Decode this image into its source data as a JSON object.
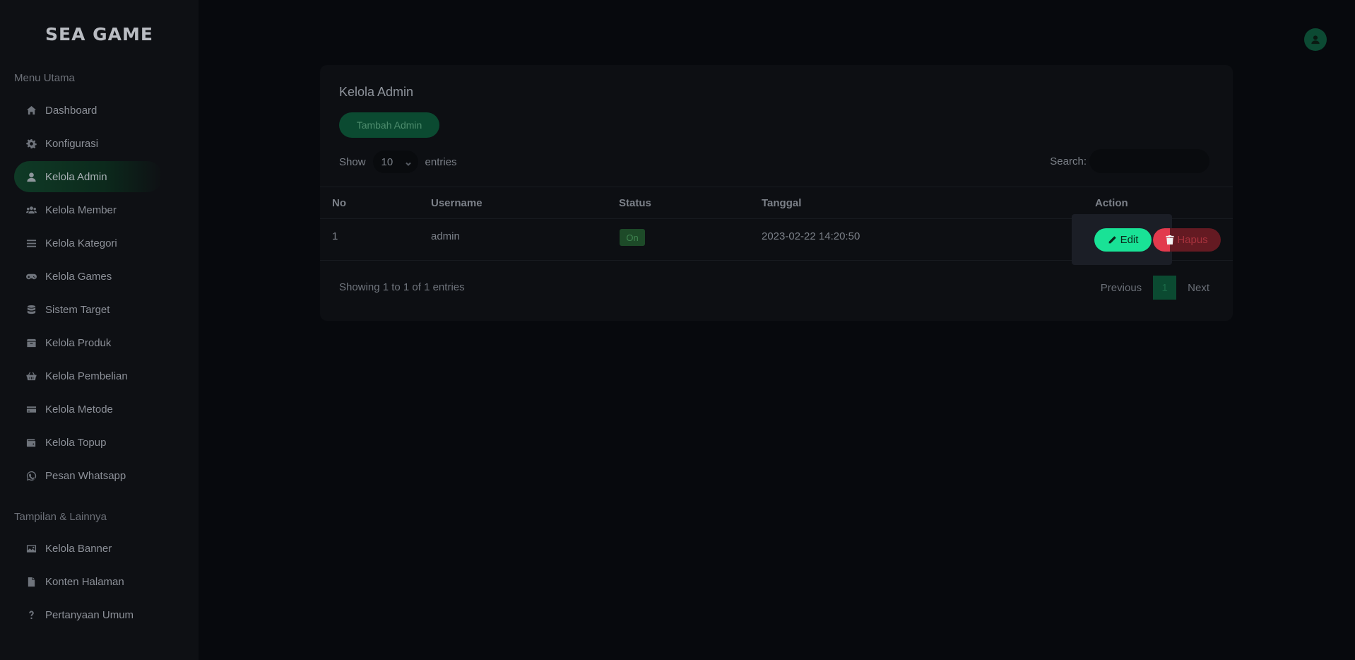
{
  "brand": {
    "logo_text": "SEA GAME"
  },
  "sidebar": {
    "section_main": "Menu Utama",
    "section_other": "Tampilan & Lainnya",
    "items": [
      {
        "label": "Dashboard",
        "icon": "home-icon"
      },
      {
        "label": "Konfigurasi",
        "icon": "gear-icon"
      },
      {
        "label": "Kelola Admin",
        "icon": "user-icon",
        "active": true
      },
      {
        "label": "Kelola Member",
        "icon": "users-icon"
      },
      {
        "label": "Kelola Kategori",
        "icon": "list-icon"
      },
      {
        "label": "Kelola Games",
        "icon": "gamepad-icon"
      },
      {
        "label": "Sistem Target",
        "icon": "database-icon"
      },
      {
        "label": "Kelola Produk",
        "icon": "box-icon"
      },
      {
        "label": "Kelola Pembelian",
        "icon": "basket-icon"
      },
      {
        "label": "Kelola Metode",
        "icon": "credit-card-icon"
      },
      {
        "label": "Kelola Topup",
        "icon": "wallet-icon"
      },
      {
        "label": "Pesan Whatsapp",
        "icon": "whatsapp-icon"
      },
      {
        "label": "Kelola Banner",
        "icon": "image-icon"
      },
      {
        "label": "Konten Halaman",
        "icon": "file-icon"
      },
      {
        "label": "Pertanyaan Umum",
        "icon": "question-icon"
      }
    ]
  },
  "header": {
    "avatar_icon": "user-circle-icon"
  },
  "card": {
    "title": "Kelola Admin",
    "add_button": "Tambah Admin",
    "show_label": "Show",
    "entries_value": "10",
    "entries_label": "entries",
    "search_label": "Search:",
    "search_value": "",
    "columns": [
      "No",
      "Username",
      "Status",
      "Tanggal",
      "Action"
    ],
    "rows": [
      {
        "no": "1",
        "username": "admin",
        "status": "On",
        "tanggal": "2023-02-22 14:20:50"
      }
    ],
    "edit_label": "Edit",
    "delete_label": "Hapus",
    "info": "Showing 1 to 1 of 1 entries",
    "pager": {
      "previous": "Previous",
      "current": "1",
      "next": "Next"
    }
  },
  "colors": {
    "accent": "#19e296",
    "danger": "#e23a4d",
    "sidebar_bg": "#0e1014",
    "page_bg": "#07090d"
  }
}
